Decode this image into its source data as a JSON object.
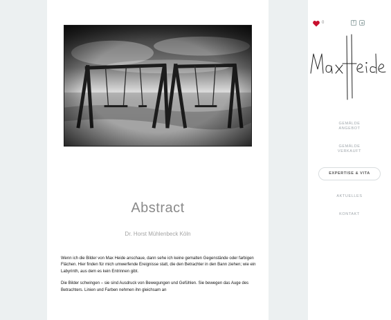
{
  "main": {
    "title": "Abstract",
    "author": "Dr. Horst Mühlenbeck Köln",
    "paragraphs": [
      "Wenn ich die Bilder von Max Heide anschaue, dann sehe ich keine gemalten Gegenstände oder farbigen Flächen. Hier finden für mich umwerfende Ereignisse statt, die den Betrachter in den Bann ziehen; wie ein Labyrinth, aus dem es kein Entrinnen gibt.",
      "Die Bilder schwingen – sie sind Ausdruck von Bewegungen und Gefühlen. Sie bewegen das Auge des Betrachters. Linien und Farben nehmen ihn gleichsam an"
    ]
  },
  "sidebar": {
    "like_count": "0",
    "icons": {
      "like": "heart-icon",
      "facebook": "facebook-icon",
      "instagram": "instagram-icon"
    },
    "nav": [
      {
        "label_line1": "GEMÄLDE",
        "label_line2": "ANGEBOT"
      },
      {
        "label_line1": "GEMÄLDE",
        "label_line2": "VERKAUFT"
      },
      {
        "label_line1": "EXPERTISE & VITA",
        "label_line2": ""
      },
      {
        "label_line1": "AKTUELLES",
        "label_line2": ""
      },
      {
        "label_line1": "KONTAKT",
        "label_line2": ""
      }
    ],
    "active_index": 2
  },
  "colors": {
    "background": "#ecf0f1",
    "heart": "#c8102e",
    "nav_text": "#9fa6ab"
  }
}
